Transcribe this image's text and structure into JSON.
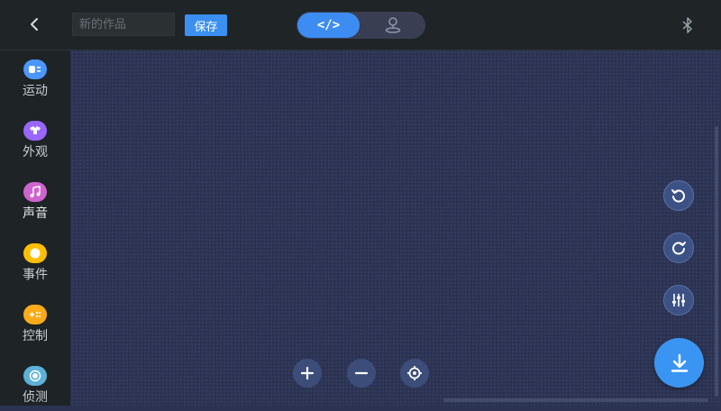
{
  "header": {
    "project_name_placeholder": "新的作品",
    "save_label": "保存",
    "code_mode_label": "</>",
    "stage_mode_icon": "stage-icon",
    "bluetooth_icon": "bluetooth-icon"
  },
  "sidebar": {
    "items": [
      {
        "label": "运动",
        "color": "#4c97ff",
        "icon": "motion-icon"
      },
      {
        "label": "外观",
        "color": "#9966ff",
        "icon": "looks-icon"
      },
      {
        "label": "声音",
        "color": "#cf63cf",
        "icon": "sound-icon"
      },
      {
        "label": "事件",
        "color": "#ffbf00",
        "icon": "events-icon"
      },
      {
        "label": "控制",
        "color": "#ffab19",
        "icon": "control-icon"
      },
      {
        "label": "侦测",
        "color": "#5cb1d6",
        "icon": "sensing-icon"
      }
    ]
  },
  "workspace": {
    "side_controls": [
      "undo-icon",
      "redo-icon",
      "settings-sliders-icon"
    ],
    "zoom_controls": [
      "zoom-in-icon",
      "zoom-out-icon",
      "recenter-icon"
    ],
    "download_icon": "download-icon"
  },
  "colors": {
    "accent": "#3d8cf2",
    "workspace_bg": "#2c3352",
    "topbar_bg": "#1f2427",
    "sidebar_bg": "#1e2326"
  }
}
